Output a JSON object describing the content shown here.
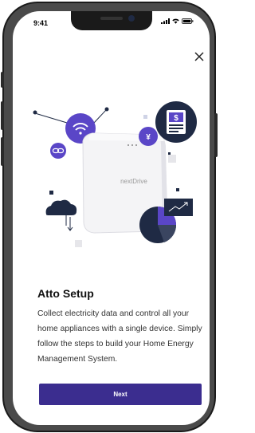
{
  "status_bar": {
    "time": "9:41"
  },
  "device": {
    "brand": "nextDrive"
  },
  "onboarding": {
    "title": "Atto Setup",
    "description": "Collect electricity data and control all your home appliances with a single device. Simply follow the steps to build your Home Energy Management System.",
    "next_label": "Next"
  },
  "icons": {
    "close": "close-icon",
    "wifi": "wifi-icon",
    "link": "link-icon",
    "yen": "yen-icon",
    "dollar": "dollar-document-icon",
    "cloud": "cloud-sync-icon",
    "pie": "pie-chart-icon",
    "trend": "trend-chart-icon"
  },
  "colors": {
    "accent": "#3b2d8f",
    "purple": "#5a46c7",
    "navy": "#1f2a44"
  }
}
